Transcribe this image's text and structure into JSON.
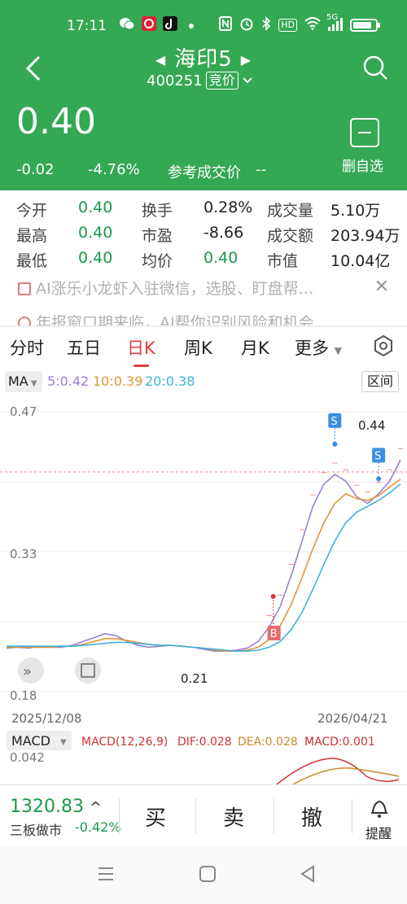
{
  "status_bar": {
    "time": "17:11",
    "icons": [
      "wechat-icon",
      "app-icon",
      "tiktok-icon",
      "dot-icon",
      "nfc-icon",
      "alarm-icon",
      "bluetooth-icon",
      "hd-icon",
      "wifi-icon",
      "signal-5g-icon",
      "battery-icon"
    ],
    "hd_text": "HD",
    "net_text": "5G",
    "battery_level": 0.85
  },
  "header": {
    "title": "海印5",
    "code": "400251",
    "tag": "竞价",
    "price": "0.40",
    "change": "-0.02",
    "change_pct": "-4.76%",
    "ref_label": "参考成交价",
    "ref_value": "--",
    "watchlist_label": "删自选",
    "bg_color": "#35a853"
  },
  "stats": {
    "rows": [
      [
        {
          "label": "今开",
          "value": "0.40"
        },
        {
          "label": "换手",
          "value": "0.28%"
        },
        {
          "label": "成交量",
          "value": "5.10万"
        }
      ],
      [
        {
          "label": "最高",
          "value": "0.40"
        },
        {
          "label": "市盈",
          "value": "-8.66"
        },
        {
          "label": "成交额",
          "value": "203.94万"
        }
      ],
      [
        {
          "label": "最低",
          "value": "0.40"
        },
        {
          "label": "均价",
          "value": "0.40"
        },
        {
          "label": "市值",
          "value": "10.04亿"
        }
      ]
    ]
  },
  "news": {
    "line1": "AI涨乐小龙虾入驻微信，选股、盯盘帮…",
    "line2": "年报窗口期来临，AI帮你识别风险和机会"
  },
  "tabs": {
    "items": [
      "分时",
      "五日",
      "日K",
      "周K",
      "月K",
      "更多"
    ],
    "active": "日K"
  },
  "ma": {
    "label": "MA",
    "ma5": "5:0.42",
    "ma10": "10:0.39",
    "ma20": "20:0.38",
    "zone_label": "区间",
    "colors": {
      "ma5": "#9b7fd4",
      "ma10": "#e0953a",
      "ma20": "#3fb1e0",
      "price": "#7d5cc9"
    }
  },
  "chart_data": {
    "type": "line",
    "ylim": [
      0.18,
      0.47
    ],
    "y_ticks": [
      "0.47",
      "0.33",
      "0.18"
    ],
    "x_labels": [
      "2025/12/08",
      "2026/04/21"
    ],
    "low_label": "0.21",
    "high_label": "0.44",
    "buy_label": "B",
    "sell_label": "S",
    "macd": {
      "label": "MACD",
      "params": "MACD(12,26,9)",
      "dif": "DIF:0.028",
      "dea": "DEA:0.028",
      "macd": "MACD:0.001",
      "top_value": "0.042"
    },
    "series": [
      {
        "name": "MA5",
        "values": [
          0.225,
          0.226,
          0.225,
          0.227,
          0.226,
          0.226,
          0.228,
          0.232,
          0.236,
          0.24,
          0.238,
          0.232,
          0.228,
          0.226,
          0.227,
          0.228,
          0.227,
          0.226,
          0.224,
          0.222,
          0.222,
          0.223,
          0.225,
          0.232,
          0.247,
          0.268,
          0.3,
          0.336,
          0.372,
          0.395,
          0.405,
          0.398,
          0.382,
          0.375,
          0.385,
          0.398,
          0.42
        ]
      },
      {
        "name": "MA10",
        "values": [
          0.226,
          0.226,
          0.226,
          0.226,
          0.226,
          0.227,
          0.227,
          0.229,
          0.232,
          0.235,
          0.235,
          0.233,
          0.231,
          0.229,
          0.228,
          0.228,
          0.227,
          0.226,
          0.225,
          0.223,
          0.222,
          0.222,
          0.223,
          0.226,
          0.234,
          0.248,
          0.27,
          0.298,
          0.328,
          0.355,
          0.375,
          0.385,
          0.38,
          0.378,
          0.383,
          0.392,
          0.4
        ]
      },
      {
        "name": "MA20",
        "values": [
          0.227,
          0.227,
          0.227,
          0.227,
          0.227,
          0.227,
          0.227,
          0.228,
          0.229,
          0.23,
          0.231,
          0.231,
          0.23,
          0.229,
          0.228,
          0.228,
          0.227,
          0.226,
          0.225,
          0.224,
          0.223,
          0.222,
          0.222,
          0.223,
          0.226,
          0.232,
          0.244,
          0.262,
          0.286,
          0.312,
          0.336,
          0.355,
          0.366,
          0.372,
          0.378,
          0.386,
          0.395
        ]
      }
    ]
  },
  "bottom_bar": {
    "index_value": "1320.83",
    "index_arrow": "^",
    "index_name": "三板做市",
    "index_change": "-0.42%",
    "buy": "买",
    "sell": "卖",
    "cancel": "撤",
    "alert": "提醒"
  },
  "nav": {
    "icons": [
      "menu-icon",
      "home-icon",
      "back-icon"
    ]
  }
}
